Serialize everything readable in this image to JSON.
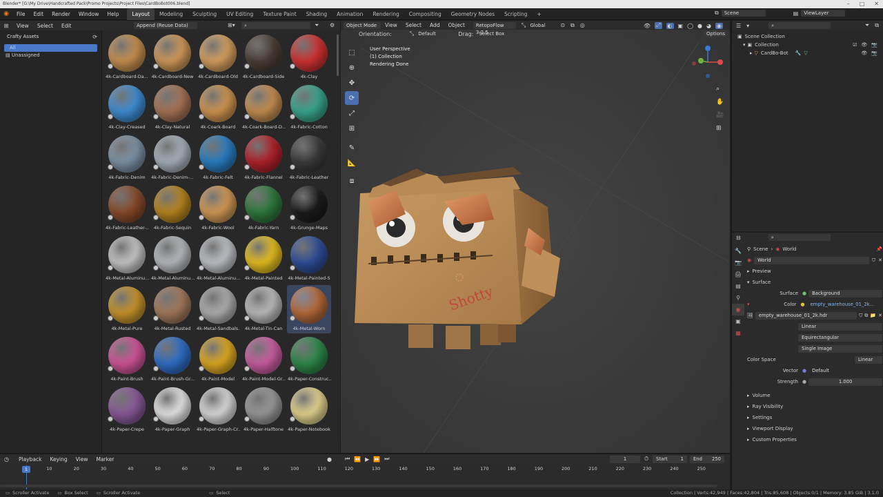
{
  "window": {
    "title": "Blender* [G:\\My Drive\\Handcrafted Pack\\Promo Projects\\Project Files\\CardBoBot006.blend]"
  },
  "topbar": {
    "menus": [
      "File",
      "Edit",
      "Render",
      "Window",
      "Help"
    ],
    "workspaces": [
      "Layout",
      "Modeling",
      "Sculpting",
      "UV Editing",
      "Texture Paint",
      "Shading",
      "Animation",
      "Rendering",
      "Compositing",
      "Geometry Nodes",
      "Scripting"
    ],
    "active_workspace": "Layout",
    "add_tab": "+",
    "scene": "Scene",
    "view_layer": "ViewLayer"
  },
  "asset_browser": {
    "menus": [
      "View",
      "Select",
      "Edit"
    ],
    "import_method": "Append (Reuse Data)",
    "library": "Crafty Assets",
    "catalogs": [
      {
        "label": "All",
        "selected": true
      },
      {
        "label": "Unassigned",
        "selected": false
      }
    ],
    "assets": [
      {
        "label": "4k-Cardboard-Da...",
        "color": "#c9914f"
      },
      {
        "label": "4k-Cardboard-New",
        "color": "#d39a5a"
      },
      {
        "label": "4k-Cardboard-Old",
        "color": "#d8a160"
      },
      {
        "label": "4k-Cardboard-Side",
        "color": "#4b3f35"
      },
      {
        "label": "4k-Clay",
        "color": "#d33232"
      },
      {
        "label": "4k-Clay-Creased",
        "color": "#3f8fd6"
      },
      {
        "label": "4k-Clay-Natural",
        "color": "#a87456"
      },
      {
        "label": "4k-Coark-Board",
        "color": "#d19650"
      },
      {
        "label": "4k-Coark-Board-D...",
        "color": "#c78f52"
      },
      {
        "label": "4k-Fabric-Cotton",
        "color": "#3aa88e"
      },
      {
        "label": "4k-Fabric-Denim",
        "color": "#7e94a8"
      },
      {
        "label": "4k-Fabric-Denim-...",
        "color": "#a9b3bd"
      },
      {
        "label": "4k-Fabric-Felt",
        "color": "#2a7fc4"
      },
      {
        "label": "4k-Fabric-Flannel",
        "color": "#b3222a"
      },
      {
        "label": "4k-Fabric-Leather",
        "color": "#3b3b3b"
      },
      {
        "label": "4k-Fabric-Leather-...",
        "color": "#8a4b2a"
      },
      {
        "label": "4k-Fabric-Sequin",
        "color": "#b8861e"
      },
      {
        "label": "4k-Fabric-Wool",
        "color": "#d49a55"
      },
      {
        "label": "4k-Fabric-Yarn",
        "color": "#2e7a3c"
      },
      {
        "label": "4k-Grunge-Maps",
        "color": "#1c1c1c"
      },
      {
        "label": "4k-Metal-Aluminu...",
        "color": "#c8c8c8"
      },
      {
        "label": "4k-Metal-Aluminu...",
        "color": "#b9bcc0"
      },
      {
        "label": "4k-Metal-Aluminu...",
        "color": "#c2c5c9"
      },
      {
        "label": "4k-Metal-Painted",
        "color": "#e8c020"
      },
      {
        "label": "4k-Metal-Painted-S",
        "color": "#2f4f9a"
      },
      {
        "label": "4k-Metal-Pure",
        "color": "#c9952b"
      },
      {
        "label": "4k-Metal-Rusted",
        "color": "#a57a5c"
      },
      {
        "label": "4k-Metal-Sandbals...",
        "color": "#b0b0b0"
      },
      {
        "label": "4k-Metal-Tin-Can",
        "color": "#bdbdbd"
      },
      {
        "label": "4k-Metal-Worn",
        "color": "#b76a3a"
      },
      {
        "label": "4k-Paint-Brush",
        "color": "#d3559a"
      },
      {
        "label": "4k-Paint-Brush-Gr...",
        "color": "#2f6fc9"
      },
      {
        "label": "4k-Paint-Model",
        "color": "#e0aa22"
      },
      {
        "label": "4k-Paint-Model-Gr...",
        "color": "#cc5fa2"
      },
      {
        "label": "4k-Paper-Construc...",
        "color": "#2e8a4a"
      },
      {
        "label": "4k-Paper-Crepe",
        "color": "#8b5a9a"
      },
      {
        "label": "4k-Paper-Graph",
        "color": "#e8e8e8"
      },
      {
        "label": "4k-Paper-Graph-Cr...",
        "color": "#dcdcdc"
      },
      {
        "label": "4k-Paper-Halftone",
        "color": "#9a9a9a"
      },
      {
        "label": "4k-Paper-Notebook",
        "color": "#e6d690"
      }
    ],
    "selected_asset": "4k-Metal-Worn"
  },
  "viewport": {
    "mode": "Object Mode",
    "menus": [
      "View",
      "Select",
      "Add",
      "Object"
    ],
    "addon": "RetopoFlow 3.2.5",
    "transform": "Global",
    "orientation_label": "Orientation:",
    "orientation": "Default",
    "drag_label": "Drag:",
    "drag": "Select Box",
    "options": "Options",
    "overlay_lines": [
      "User Perspective",
      "(1) Collection",
      "Rendering Done"
    ],
    "model_text": "Shotty"
  },
  "outliner": {
    "root": "Scene Collection",
    "collection": "Collection",
    "object": "CardBo-Bot"
  },
  "properties": {
    "breadcrumb": [
      "Scene",
      "World"
    ],
    "world_name": "World",
    "panels": {
      "preview": "Preview",
      "surface": "Surface",
      "volume": "Volume",
      "ray_visibility": "Ray Visibility",
      "settings": "Settings",
      "viewport_display": "Viewport Display",
      "custom_properties": "Custom Properties"
    },
    "surface_label": "Surface",
    "surface_value": "Background",
    "color_label": "Color",
    "color_value": "empty_warehouse_01_2k...",
    "image_name": "empty_warehouse_01_2k.hdr",
    "interpolation": "Linear",
    "projection": "Equirectangular",
    "source": "Single Image",
    "color_space_label": "Color Space",
    "color_space": "Linear",
    "vector_label": "Vector",
    "vector_value": "Default",
    "strength_label": "Strength",
    "strength_value": "1.000"
  },
  "timeline": {
    "menus": [
      "Playback",
      "Keying",
      "View",
      "Marker"
    ],
    "current_frame": "1",
    "start_label": "Start",
    "start": "1",
    "end_label": "End",
    "end": "250",
    "ticks": [
      "10",
      "20",
      "30",
      "40",
      "50",
      "60",
      "70",
      "80",
      "90",
      "100",
      "110",
      "120",
      "130",
      "140",
      "150",
      "160",
      "170",
      "180",
      "190",
      "200",
      "210",
      "220",
      "230",
      "240",
      "250"
    ],
    "playhead": "1"
  },
  "statusbar": {
    "left": [
      "Scroller Activate",
      "Box Select",
      "Scroller Activate",
      "Select"
    ],
    "right": "Collection | Verts:42,949 | Faces:42,804 | Tris:85,608 | Objects:0/1 | Memory: 3.85 GiB | 3.1.0"
  }
}
